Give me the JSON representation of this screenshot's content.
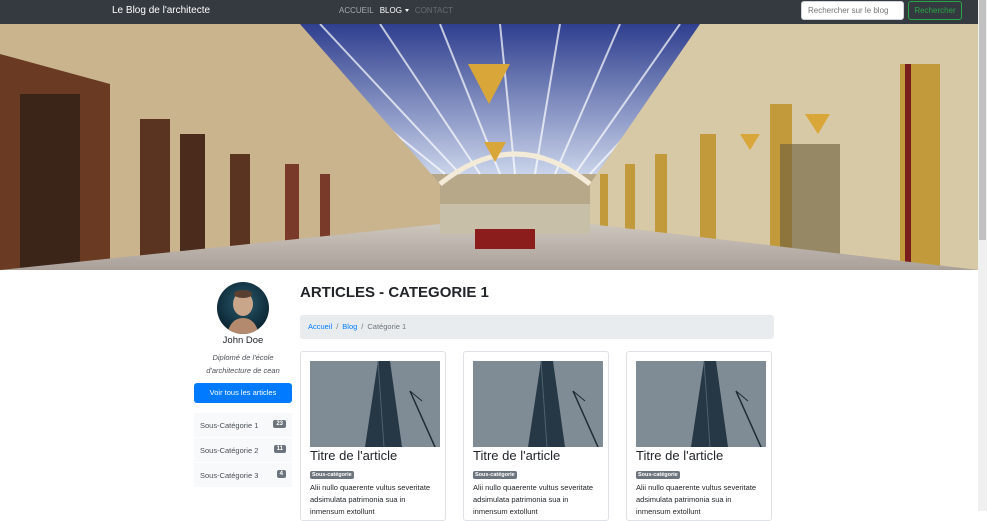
{
  "navbar": {
    "brand": "Le Blog de l'architecte",
    "items": [
      {
        "label": "ACCUEIL"
      },
      {
        "label": "BLOG"
      },
      {
        "label": "CONTACT"
      }
    ],
    "search": {
      "placeholder": "Rechercher sur le blog",
      "button_label": "Rechercher"
    }
  },
  "carousel": {
    "slide_count": 3,
    "active_index": 0
  },
  "sidebar": {
    "profile": {
      "name": "John Doe",
      "description": "Diplomé de l'école d'architecture de cean"
    },
    "all_articles_label": "Voir tous les articles",
    "categories": [
      {
        "label": "Sous-Catégorie 1",
        "count": "23"
      },
      {
        "label": "Sous-Catégorie 2",
        "count": "11"
      },
      {
        "label": "Sous-Catégorie 3",
        "count": "4"
      }
    ]
  },
  "main": {
    "title": "ARTICLES - CATEGORIE 1",
    "breadcrumb": [
      {
        "label": "Accueil"
      },
      {
        "label": "Blog"
      },
      {
        "label": "Catégorie 1"
      }
    ],
    "articles": [
      {
        "title": "Titre de l'article",
        "badge": "Sous-catégorie",
        "excerpt": "Alii nullo quaerente vultus severitate adsimulata patrimonia sua in inmensum extollunt"
      },
      {
        "title": "Titre de l'article",
        "badge": "Sous-catégorie",
        "excerpt": "Alii nullo quaerente vultus severitate adsimulata patrimonia sua in inmensum extollunt"
      },
      {
        "title": "Titre de l'article",
        "badge": "Sous-catégorie",
        "excerpt": "Alii nullo quaerente vultus severitate adsimulata patrimonia sua in inmensum extollunt"
      }
    ]
  },
  "colors": {
    "navbar": "#343a40",
    "primary": "#007bff",
    "success": "#28a745",
    "badge": "#6c757d"
  }
}
